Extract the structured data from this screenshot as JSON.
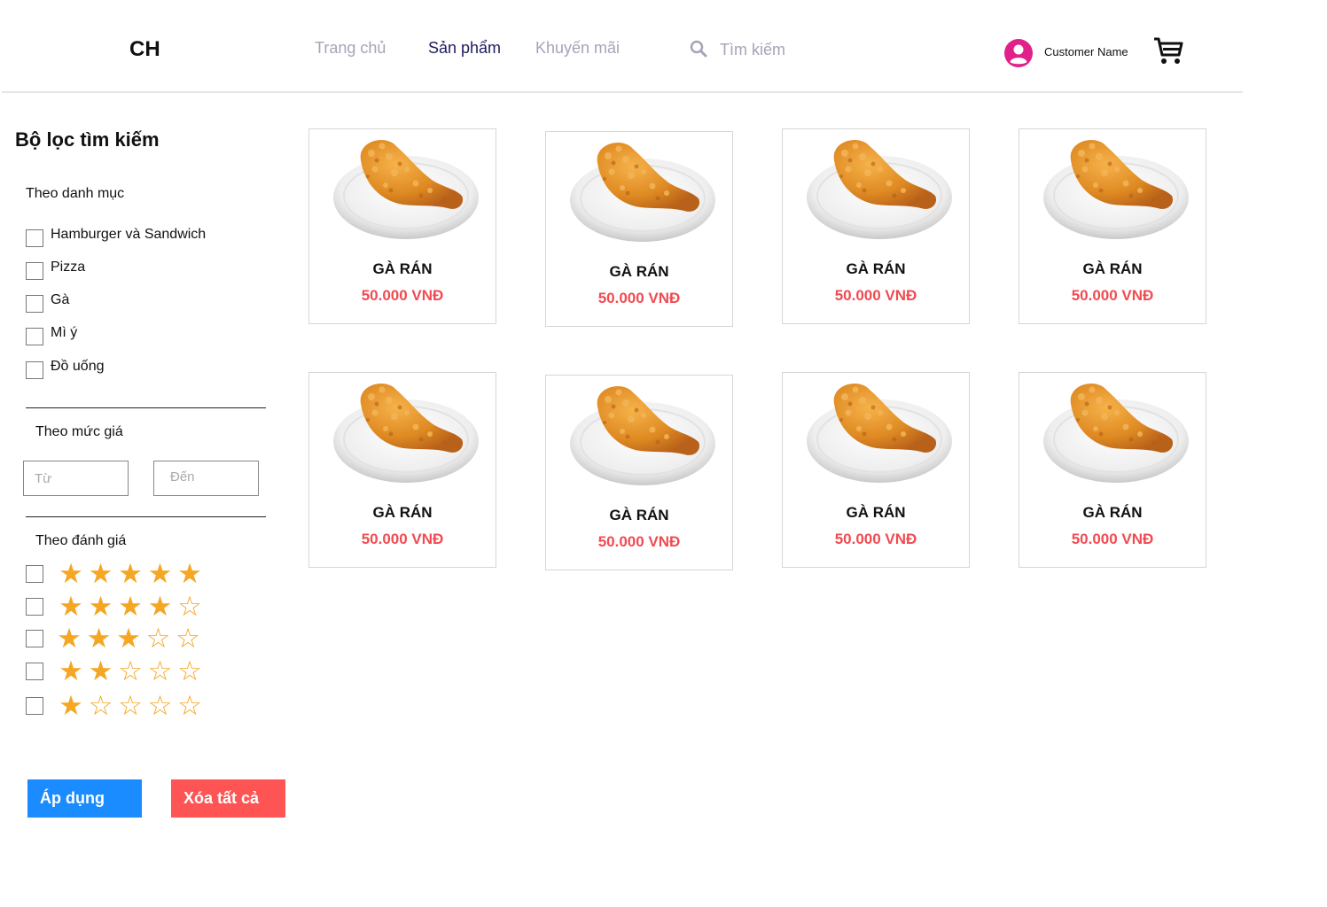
{
  "header": {
    "logo": "CH",
    "nav": [
      {
        "label": "Trang chủ",
        "active": false
      },
      {
        "label": "Sản phẩm",
        "active": true
      },
      {
        "label": "Khuyến mãi",
        "active": false
      }
    ],
    "search_placeholder": "Tìm kiếm",
    "user_name": "Customer Name",
    "icons": [
      "search-icon",
      "user-avatar-icon",
      "cart-icon"
    ]
  },
  "sidebar": {
    "title": "Bộ lọc tìm kiếm",
    "category_label": "Theo danh mục",
    "categories": [
      "Hamburger và Sandwich",
      "Pizza",
      "Gà",
      "Mì ý",
      "Đồ uống"
    ],
    "price_label": "Theo mức giá",
    "price_from_placeholder": "Từ",
    "price_to_placeholder": "Đến",
    "rating_label": "Theo đánh giá",
    "ratings": [
      5,
      4,
      3,
      2,
      1
    ],
    "apply_label": "Áp dụng",
    "clear_label": "Xóa tất cả"
  },
  "products": [
    {
      "name": "GÀ RÁN",
      "price": "50.000 VNĐ"
    },
    {
      "name": "GÀ RÁN",
      "price": "50.000 VNĐ"
    },
    {
      "name": "GÀ RÁN",
      "price": "50.000 VNĐ"
    },
    {
      "name": "GÀ RÁN",
      "price": "50.000 VNĐ"
    },
    {
      "name": "GÀ RÁN",
      "price": "50.000 VNĐ"
    },
    {
      "name": "GÀ RÁN",
      "price": "50.000 VNĐ"
    },
    {
      "name": "GÀ RÁN",
      "price": "50.000 VNĐ"
    },
    {
      "name": "GÀ RÁN",
      "price": "50.000 VNĐ"
    }
  ],
  "colors": {
    "apply_button": "#1a8cff",
    "clear_button": "#ff5454",
    "price": "#f14b52",
    "star": "#f5a623",
    "avatar": "#e0218a",
    "nav_active": "#1e1b5e",
    "nav_inactive": "#a8a3b8"
  }
}
